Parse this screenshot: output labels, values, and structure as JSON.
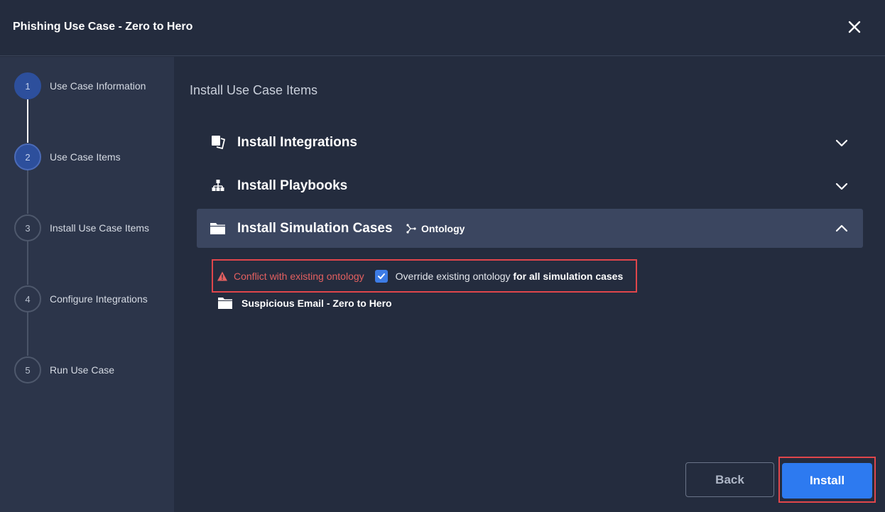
{
  "header": {
    "title": "Phishing Use Case - Zero to Hero",
    "close_icon": "close-icon"
  },
  "steps": [
    {
      "number": "1",
      "label": "Use Case Information",
      "state": "completed"
    },
    {
      "number": "2",
      "label": "Use Case Items",
      "state": "current"
    },
    {
      "number": "3",
      "label": "Install Use Case Items",
      "state": "pending"
    },
    {
      "number": "4",
      "label": "Configure Integrations",
      "state": "pending"
    },
    {
      "number": "5",
      "label": "Run Use Case",
      "state": "pending"
    }
  ],
  "main": {
    "title": "Install Use Case Items",
    "sections": [
      {
        "label": "Install Integrations",
        "icon": "integrations-icon",
        "expanded": false
      },
      {
        "label": "Install Playbooks",
        "icon": "playbooks-icon",
        "expanded": false
      },
      {
        "label": "Install Simulation Cases",
        "icon": "folder-icon",
        "expanded": true,
        "tag": "Ontology",
        "tag_icon": "ontology-icon"
      }
    ],
    "conflict": {
      "warning": "Conflict with existing ontology",
      "override_prefix": "Override existing ontology ",
      "override_bold": "for all simulation cases",
      "checked": true
    },
    "cases": [
      {
        "name": "Suspicious Email - Zero to Hero",
        "icon": "folder-icon"
      }
    ]
  },
  "footer": {
    "back_label": "Back",
    "install_label": "Install"
  },
  "colors": {
    "background": "#242c3e",
    "sidebar": "#2c354a",
    "accent": "#2d7af0",
    "highlight": "#e0464b",
    "warning": "#e46060"
  }
}
